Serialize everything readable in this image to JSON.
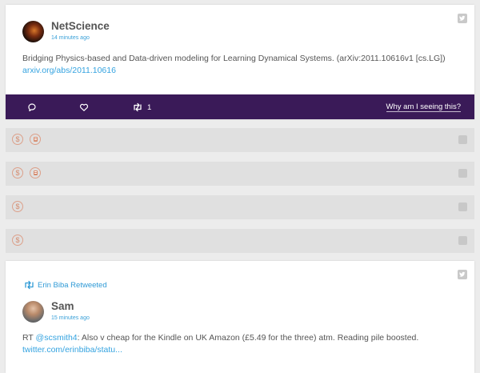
{
  "tweet1": {
    "author_name": "NetScience",
    "time": "14 minutes ago",
    "text": "Bridging Physics-based and Data-driven modeling for Learning Dynamical Systems. (arXiv:2011.10616v1 [cs.LG])",
    "link": "arxiv.org/abs/2011.10616",
    "actions": {
      "reply_icon": "reply-icon",
      "like_icon": "heart-icon",
      "retweet_icon": "retweet-icon",
      "retweet_count": "1",
      "why_label": "Why am I seeing this?"
    },
    "colors": {
      "action_bar": "#3a1a58",
      "link": "#34a3e0"
    }
  },
  "placeholders": [
    {
      "icons": [
        "dollar-icon",
        "document-icon"
      ]
    },
    {
      "icons": [
        "dollar-icon",
        "document-icon"
      ]
    },
    {
      "icons": [
        "dollar-icon"
      ]
    },
    {
      "icons": [
        "dollar-icon"
      ]
    }
  ],
  "placeholder_glyphs": {
    "dollar": "$"
  },
  "tweet2": {
    "retweeted_by": "Erin Biba Retweeted",
    "author_name": "Sam",
    "time": "15 minutes ago",
    "text_prefix": "RT ",
    "mention": "@scsmith4",
    "text_rest": ": Also v cheap for the Kindle on UK Amazon (£5.49 for the three) atm. Reading pile boosted.",
    "link": "twitter.com/erinbiba/statu..."
  }
}
